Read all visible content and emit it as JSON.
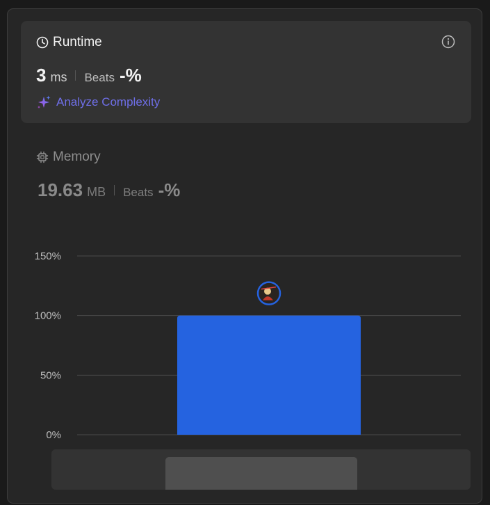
{
  "runtime": {
    "title": "Runtime",
    "value": "3",
    "unit": "ms",
    "beats_label": "Beats",
    "beats_value": "-%",
    "analyze_label": "Analyze Complexity"
  },
  "memory": {
    "title": "Memory",
    "value": "19.63",
    "unit": "MB",
    "beats_label": "Beats",
    "beats_value": "-%"
  },
  "colors": {
    "bar": "#2563e0",
    "analyze_text": "#6f6fe8",
    "gridline": "#4a4a4a"
  },
  "icons": {
    "runtime": "clock-icon",
    "memory": "chip-icon",
    "info": "info-icon",
    "analyze": "sparkle-icon",
    "marker": "user-avatar"
  },
  "chart_data": {
    "type": "bar",
    "y_ticks": [
      "150%",
      "100%",
      "50%",
      "0%"
    ],
    "ylim": [
      0,
      150
    ],
    "values": [
      100
    ],
    "grid": true,
    "marker_on_bar": true
  }
}
